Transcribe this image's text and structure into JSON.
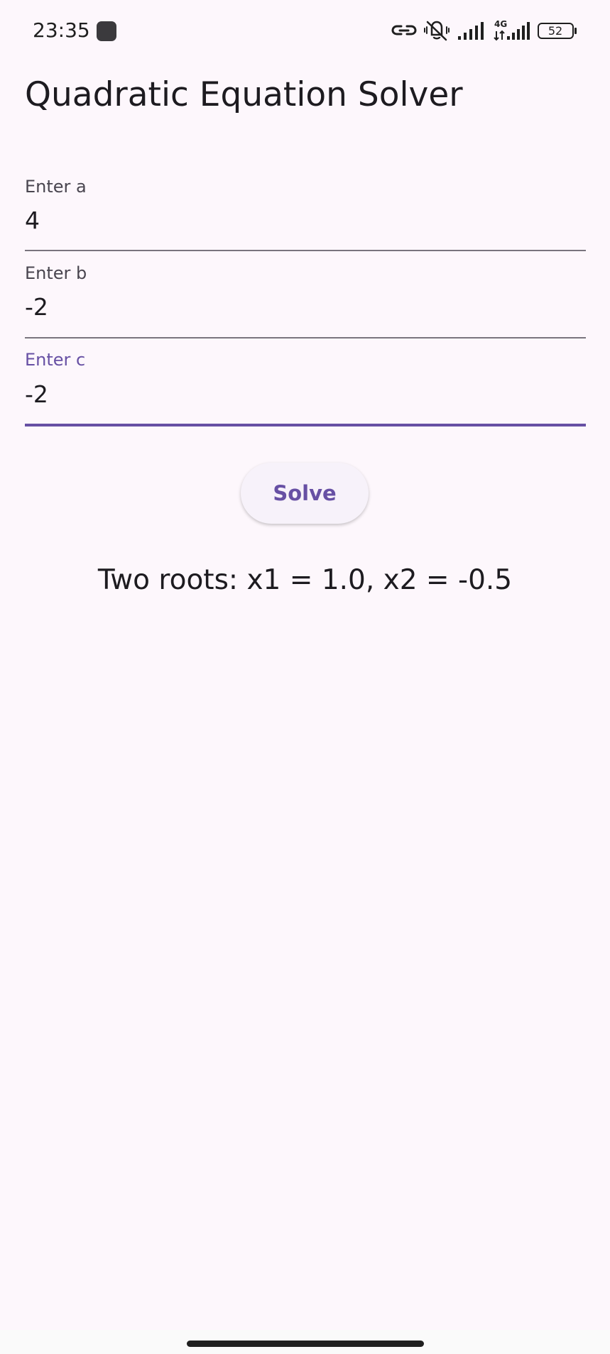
{
  "status_bar": {
    "time": "23:35",
    "battery_level": "52",
    "network_type": "4G",
    "icons": [
      "app-notification-icon",
      "link-icon",
      "vibrate-mute-icon",
      "signal-icon",
      "signal-4g-icon",
      "battery-icon"
    ]
  },
  "app": {
    "title": "Quadratic Equation Solver"
  },
  "fields": [
    {
      "label": "Enter a",
      "value": "4"
    },
    {
      "label": "Enter b",
      "value": "-2"
    },
    {
      "label": "Enter c",
      "value": "-2"
    }
  ],
  "solve_button": {
    "label": "Solve"
  },
  "result": {
    "text": "Two roots: x1 = 1.0, x2 = -0.5"
  },
  "colors": {
    "background": "#fdf7fc",
    "accent": "#6750a4",
    "text": "#1d1b20",
    "label": "#49454f",
    "underline": "#79747e"
  }
}
